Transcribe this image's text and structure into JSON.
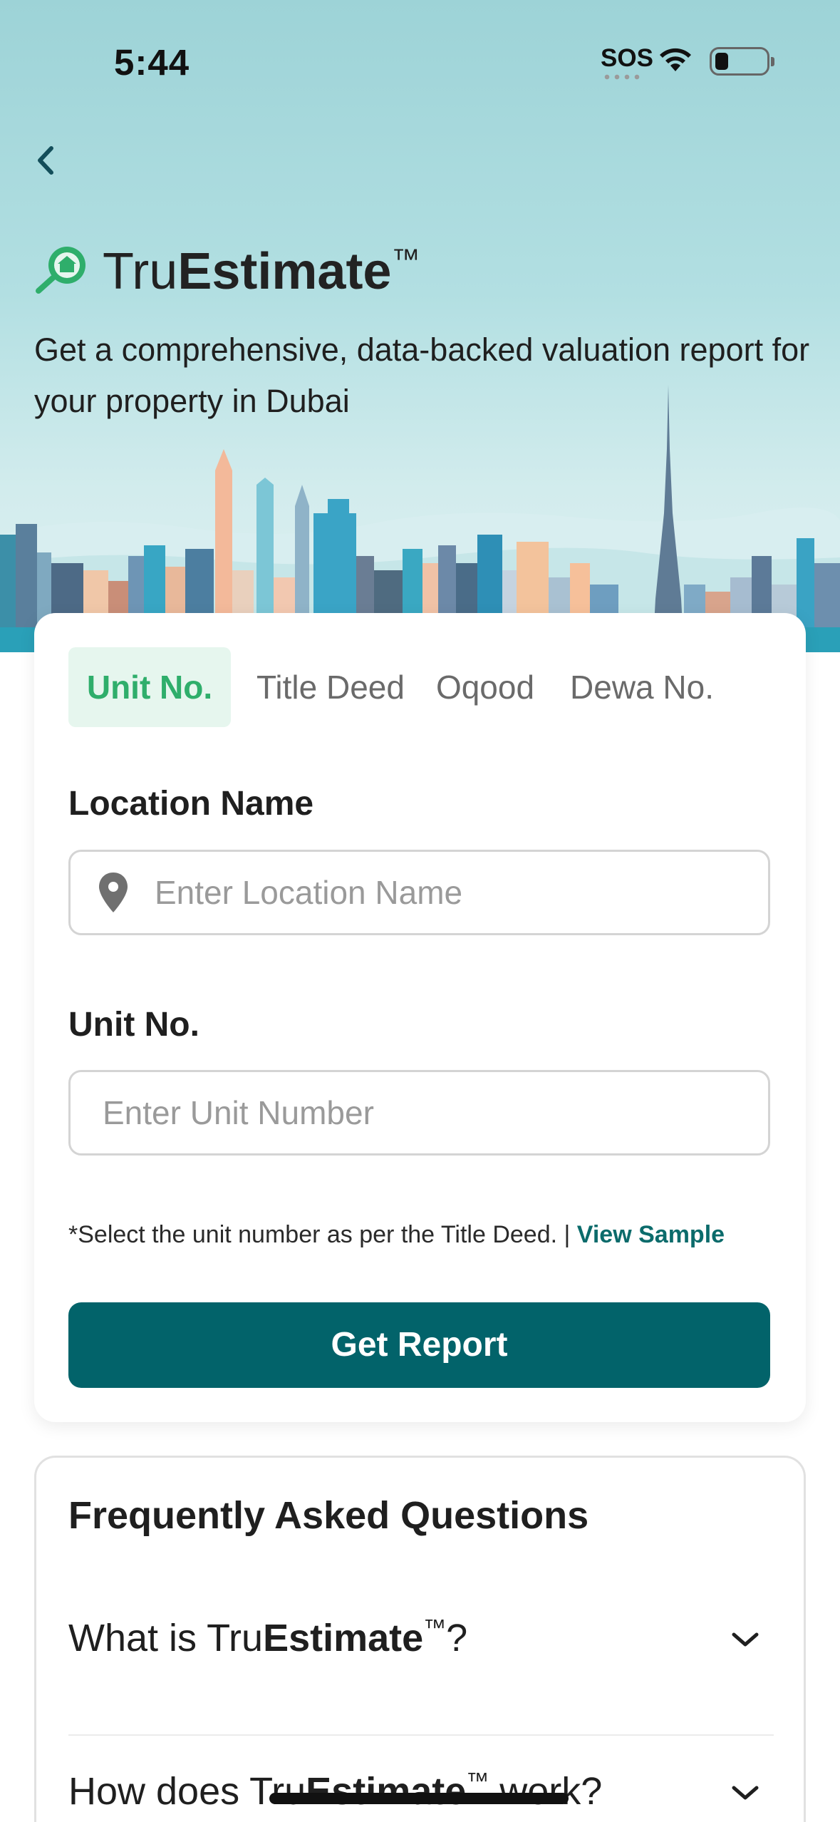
{
  "status_bar": {
    "time": "5:44",
    "sos": "SOS"
  },
  "header": {
    "brand_prefix": "Tru",
    "brand_bold": "Estimate",
    "brand_tm": "™",
    "subtitle": "Get a comprehensive, data-backed valuation report for your property in Dubai"
  },
  "tabs": [
    {
      "label": "Unit No.",
      "active": true
    },
    {
      "label": "Title Deed",
      "active": false
    },
    {
      "label": "Oqood",
      "active": false
    },
    {
      "label": "Dewa No.",
      "active": false
    }
  ],
  "form": {
    "location_label": "Location Name",
    "location_placeholder": "Enter Location Name",
    "unit_label": "Unit No.",
    "unit_placeholder": "Enter Unit Number",
    "hint_text": "*Select the unit number as per the Title Deed. | ",
    "hint_link": "View Sample",
    "submit_label": "Get Report"
  },
  "faq": {
    "title": "Frequently Asked Questions",
    "items": [
      {
        "q_prefix": "What is Tru",
        "q_bold": "Estimate",
        "q_tm": "™",
        "q_suffix": "?"
      },
      {
        "q_prefix": "How does Tru",
        "q_bold": "Estimate",
        "q_tm": "™",
        "q_suffix": " work?"
      }
    ]
  },
  "colors": {
    "accent_green": "#2fae6b",
    "primary_teal": "#02636a",
    "link_teal": "#0b6b6b",
    "hero_sky": "#9dd3d7"
  }
}
